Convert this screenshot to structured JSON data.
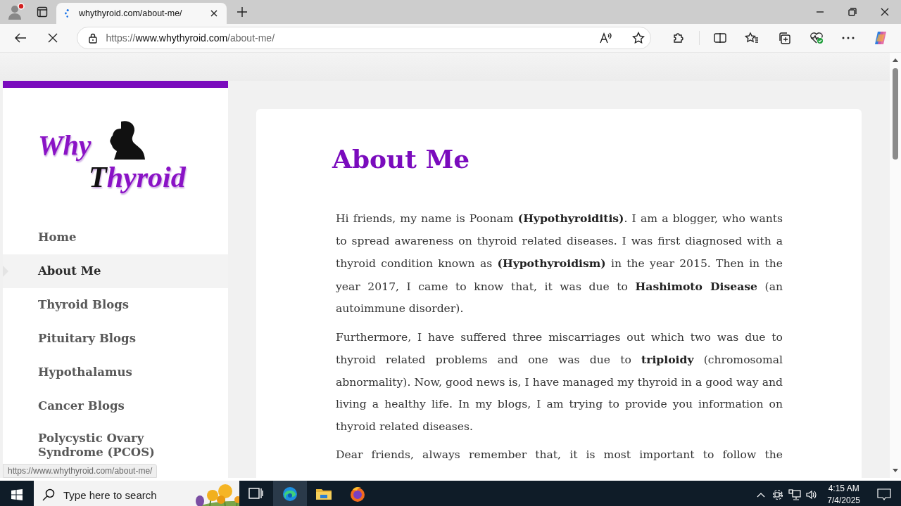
{
  "browser": {
    "loading": true,
    "tabs": [
      {
        "title": "whythyroid.com/about-me/",
        "selected": true
      }
    ],
    "address": {
      "scheme": "https://",
      "host": "www.whythyroid.com",
      "path": "/about-me/"
    },
    "status_url": "https://www.whythyroid.com/about-me/"
  },
  "page": {
    "logo": {
      "line1": "Why",
      "line2": "Thyroid"
    },
    "nav": [
      {
        "label": "Home",
        "selected": false
      },
      {
        "label": "About Me",
        "selected": true
      },
      {
        "label": "Thyroid Blogs",
        "selected": false
      },
      {
        "label": "Pituitary Blogs",
        "selected": false
      },
      {
        "label": "Hypothalamus",
        "selected": false
      },
      {
        "label": "Cancer Blogs",
        "selected": false
      },
      {
        "label": "Polycystic Ovary Syndrome (PCOS)",
        "selected": false
      }
    ],
    "article": {
      "title": "About Me",
      "paragraphs": [
        "Hi friends, my name is Poonam **(Hypothyroiditis)**. I am a blogger, who wants to spread awareness on thyroid related diseases. I was first diagnosed with a thyroid condition known as **(Hypothyroidism)** in the year 2015. Then in the year 2017, I came to know that, it was due to **Hashimoto Disease** (an autoimmune disorder).",
        "Furthermore, I have suffered three miscarriages out which two was due to thyroid related problems and one was due to **triploidy** (chromosomal abnormality). Now, good news is, I have managed my thyroid in a good way and living a healthy life. In my blogs, I am trying to provide you information on thyroid related diseases.",
        "Dear friends, always remember that, it is most important to follow the"
      ]
    }
  },
  "taskbar": {
    "search_placeholder": "Type here to search",
    "apps": [
      {
        "kind": "taskview",
        "selected": false
      },
      {
        "kind": "edge",
        "selected": true
      },
      {
        "kind": "explorer",
        "selected": false
      },
      {
        "kind": "firefox",
        "selected": false
      }
    ],
    "time": "4:15 AM",
    "date": "7/4/2025"
  }
}
